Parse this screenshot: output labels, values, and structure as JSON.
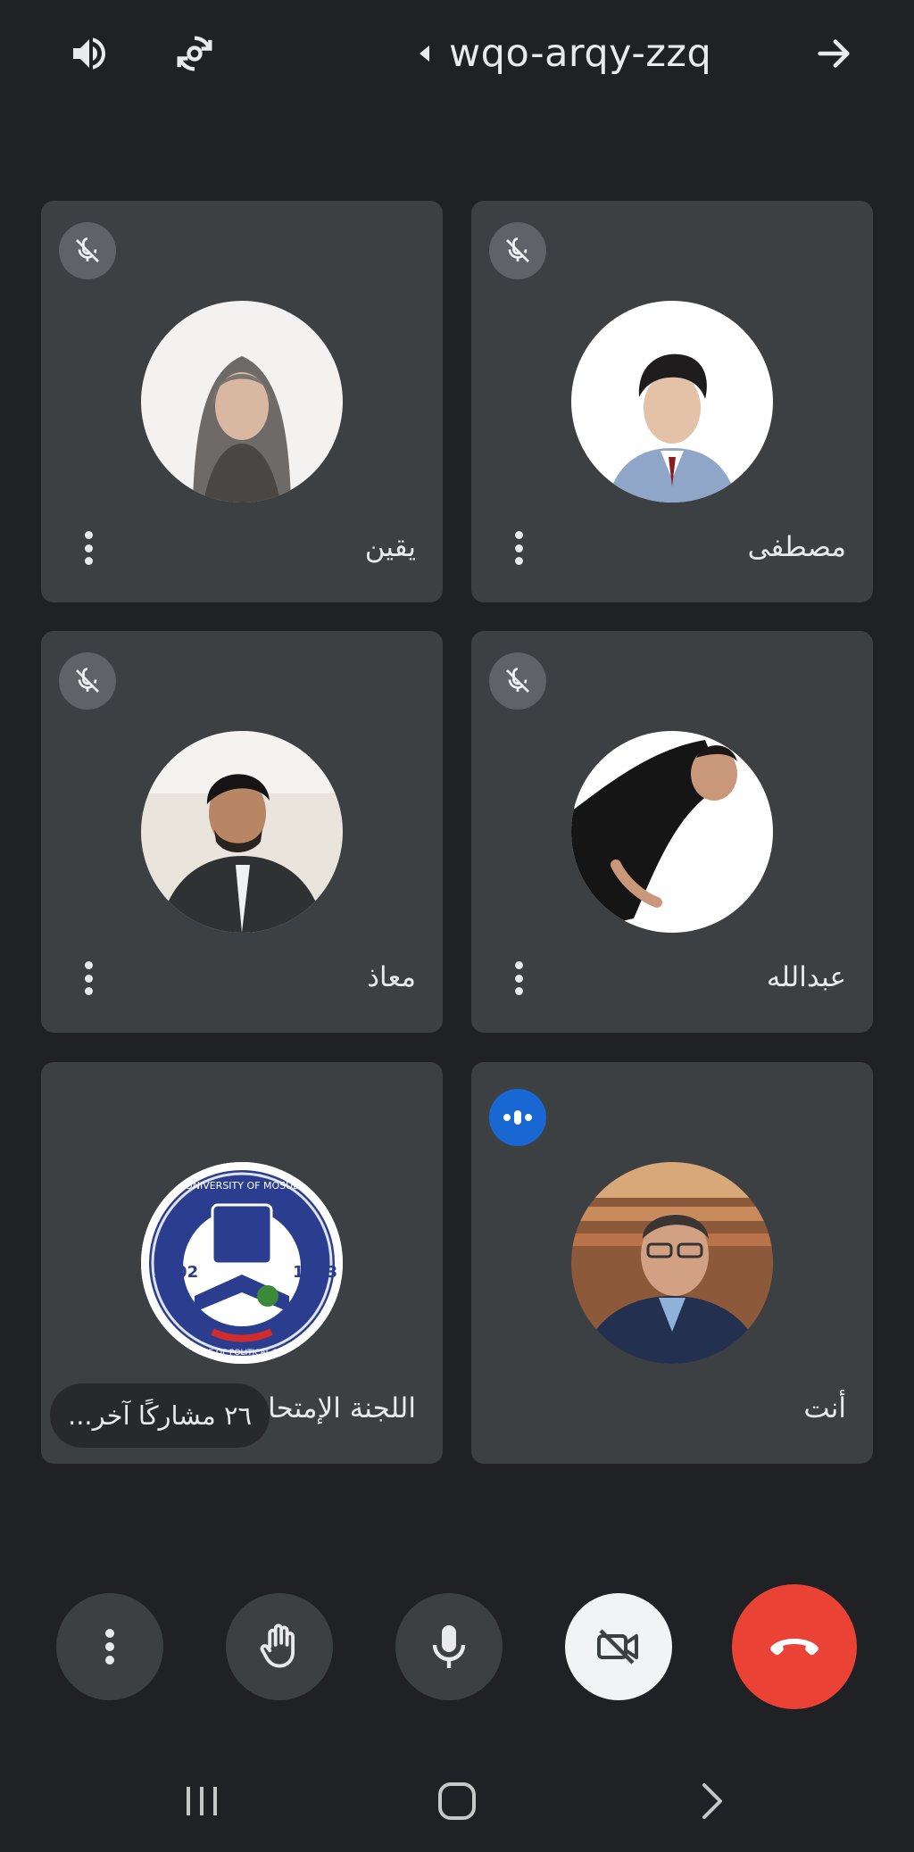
{
  "header": {
    "meeting_code": "wqo-arqy-zzq",
    "speaker_icon": "volume-icon",
    "switch_camera_icon": "switch-camera-icon",
    "arrow_icon": "arrow-right-icon"
  },
  "participants": [
    {
      "name": "يقين",
      "muted": true,
      "avatar": "photo-woman-hijab"
    },
    {
      "name": "مصطفى",
      "muted": true,
      "avatar": "photo-young-man-suit"
    },
    {
      "name": "معاذ",
      "muted": true,
      "avatar": "photo-man-dark-jacket"
    },
    {
      "name": "عبدالله",
      "muted": true,
      "avatar": "photo-man-black-shirt"
    },
    {
      "name": "اللجنة الإمتحانية",
      "muted": false,
      "avatar": "college-logo",
      "logo_top_text": "UNIVERSITY OF MOSUL",
      "logo_years": [
        "2002",
        "1423"
      ],
      "logo_bottom_text": "COLLEGE OF POLITICAL SCIENCE"
    },
    {
      "name": "أنت",
      "speaking": true,
      "avatar": "photo-man-glasses"
    }
  ],
  "others_chip": "٢٦ مشاركًا آخر...",
  "controls": [
    "more-options",
    "raise-hand",
    "microphone",
    "camera-off",
    "end-call"
  ],
  "colors": {
    "background": "#202124",
    "tile": "#3c4043",
    "end_call": "#ea4335",
    "speaking_badge": "#1967d2"
  }
}
